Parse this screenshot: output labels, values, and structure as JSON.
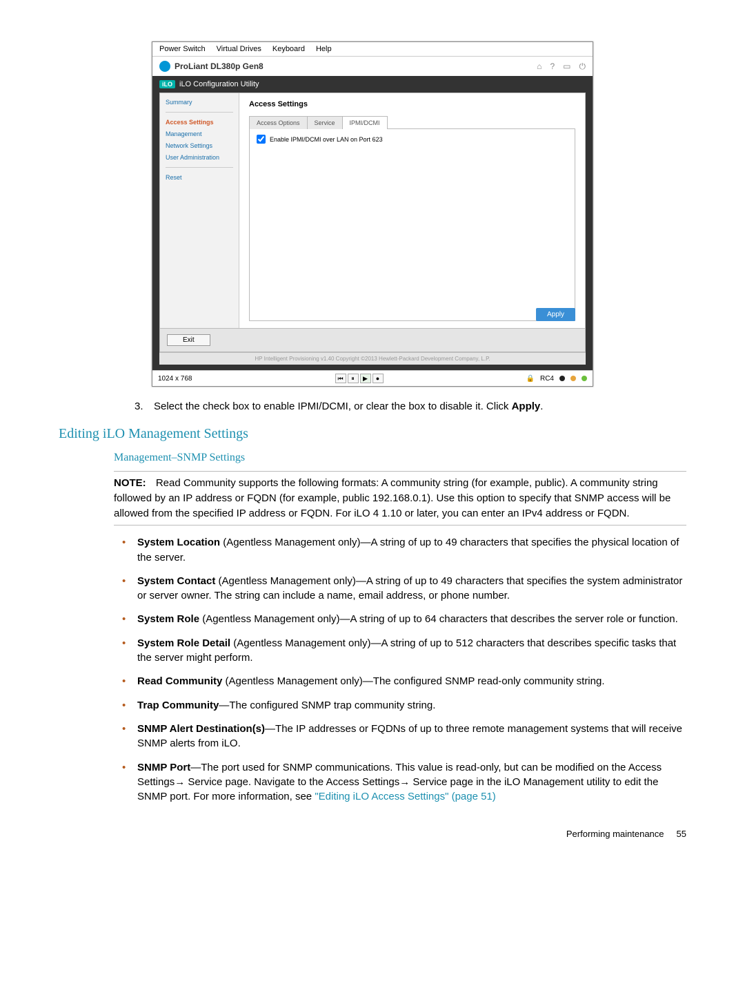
{
  "screenshot": {
    "menubar": [
      "Power Switch",
      "Virtual Drives",
      "Keyboard",
      "Help"
    ],
    "title": "ProLiant DL380p Gen8",
    "title_icons": {
      "home": "home-icon",
      "help": "help-icon",
      "lang": "lang-icon",
      "power": "power-icon"
    },
    "util_badge": "iLO",
    "util_title": "iLO Configuration Utility",
    "sidebar": {
      "items": [
        "Summary",
        "Access Settings",
        "Management",
        "Network Settings",
        "User Administration",
        "Reset"
      ],
      "active_index": 1
    },
    "main_heading": "Access Settings",
    "tabs": {
      "labels": [
        "Access Options",
        "Service",
        "IPMI/DCMI"
      ],
      "active_index": 2
    },
    "checkbox_label": "Enable IPMI/DCMI over LAN on Port 623",
    "checkbox_checked": true,
    "apply_label": "Apply",
    "exit_label": "Exit",
    "copyright": "HP Intelligent Provisioning v1.40 Copyright ©2013 Hewlett-Packard Development Company, L.P.",
    "statusbar": {
      "resolution": "1024 x 768",
      "enc_label": "RC4"
    }
  },
  "step": {
    "num": "3.",
    "text_a": "Select the check box to enable IPMI/DCMI, or clear the box to disable it. Click ",
    "apply_word": "Apply",
    "text_b": "."
  },
  "heading_main": "Editing iLO Management Settings",
  "heading_sub": "Management–SNMP Settings",
  "note": {
    "label": "NOTE:",
    "text": "Read Community supports the following formats: A community string (for example, public). A community string followed by an IP address or FQDN (for example, public 192.168.0.1). Use this option to specify that SNMP access will be allowed from the specified IP address or FQDN. For iLO 4 1.10 or later, you can enter an IPv4 address or FQDN."
  },
  "fields": [
    {
      "bold": "System Location",
      "rest": " (Agentless Management only)—A string of up to 49 characters that specifies the physical location of the server."
    },
    {
      "bold": "System Contact",
      "rest": " (Agentless Management only)—A string of up to 49 characters that specifies the system administrator or server owner. The string can include a name, email address, or phone number."
    },
    {
      "bold": "System Role",
      "rest": " (Agentless Management only)—A string of up to 64 characters that describes the server role or function."
    },
    {
      "bold": "System Role Detail",
      "rest": " (Agentless Management only)—A string of up to 512 characters that describes specific tasks that the server might perform."
    },
    {
      "bold": "Read Community",
      "rest": " (Agentless Management only)—The configured SNMP read-only community string."
    },
    {
      "bold": "Trap Community",
      "rest": "—The configured SNMP trap community string."
    },
    {
      "bold": "SNMP Alert Destination(s)",
      "rest": "—The IP addresses or FQDNs of up to three remote management systems that will receive SNMP alerts from iLO."
    },
    {
      "bold": "SNMP Port",
      "rest": "—The port used for SNMP communications. This value is read-only, but can be modified on the Access Settings→ Service page. Navigate to the Access Settings→ Service page in the iLO Management utility to edit the SNMP port. For more information, see ",
      "xref": "\"Editing iLO Access Settings\" (page 51)"
    }
  ],
  "footer": {
    "label": "Performing maintenance",
    "page": "55"
  }
}
